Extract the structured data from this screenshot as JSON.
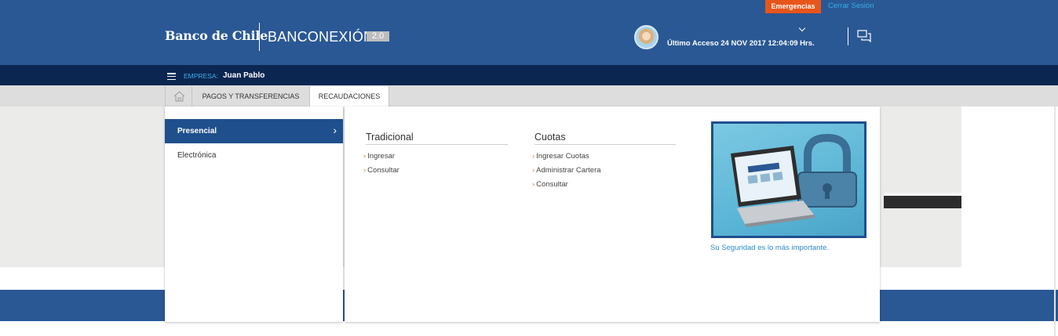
{
  "header": {
    "emergencias": "Emergencias",
    "cerrar_sesion": "Cerrar Sesión",
    "bank_name": "Banco de Chile",
    "product_name": "BANCONEXIÓN",
    "product_version": "2.0",
    "last_access": "Último Acceso 24 NOV 2017 12:04:09 Hrs."
  },
  "company_bar": {
    "label": "EMPRESA:",
    "name": "Juan Pablo"
  },
  "tabs": {
    "pagos": "PAGOS Y TRANSFERENCIAS",
    "recaudaciones": "RECAUDACIONES"
  },
  "menu": {
    "categories": [
      "Presencial",
      "Electrónica"
    ],
    "columns": [
      {
        "title": "Tradicional",
        "links": [
          "Ingresar",
          "Consultar"
        ]
      },
      {
        "title": "Cuotas",
        "links": [
          "Ingresar Cuotas",
          "Administrar Cartera",
          "Consultar"
        ]
      }
    ],
    "promo_caption": "Su Seguridad es lo más importante."
  },
  "colors": {
    "header_blue": "#2a5894",
    "company_bar": "#0c2652",
    "emergency": "#e8551b",
    "active_category": "#1f4f8d",
    "link_blue": "#36aee6"
  }
}
